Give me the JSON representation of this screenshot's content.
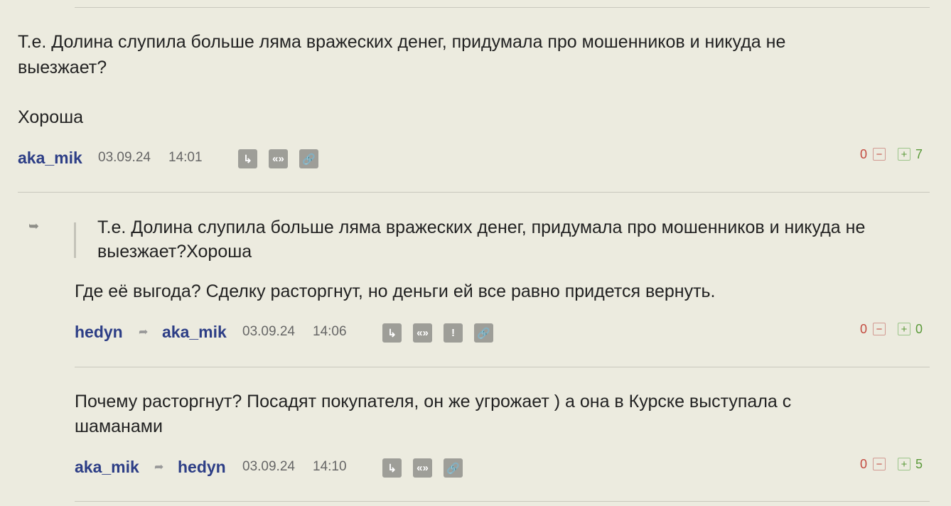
{
  "comments": [
    {
      "text_line1": "Т.е. Долина слупила больше ляма вражеских денег, придумала про мошенников и никуда не",
      "text_line2": "выезжает?",
      "text_line3": "Хороша",
      "author": "aka_mik",
      "date": "03.09.24",
      "time": "14:01",
      "votes": {
        "minus": "0",
        "plus": "7"
      }
    },
    {
      "quote_line1": "Т.е. Долина слупила больше ляма вражеских денег, придумала про мошенников и никуда не",
      "quote_line2": "выезжает?Хороша",
      "text": "Где её выгода? Сделку расторгнут, но деньги ей все равно придется вернуть.",
      "author": "hedyn",
      "reply_to": "aka_mik",
      "date": "03.09.24",
      "time": "14:06",
      "votes": {
        "minus": "0",
        "plus": "0"
      }
    },
    {
      "text_line1": "Почему расторгнут? Посадят покупателя, он же угрожает ) а она в Курске выступала с",
      "text_line2": "шаманами",
      "author": "aka_mik",
      "reply_to": "hedyn",
      "date": "03.09.24",
      "time": "14:10",
      "votes": {
        "minus": "0",
        "plus": "5"
      }
    }
  ],
  "icons": {
    "reply": "reply-arrow-icon",
    "quote": "quote-icon",
    "report": "report-icon",
    "link": "link-icon",
    "thread": "thread-arrow-icon"
  },
  "glyphs": {
    "reply": "↳",
    "quote": "«»",
    "report": "!",
    "link": "🔗",
    "thread": "➥",
    "reply_to": "➦",
    "minus": "−",
    "plus": "+"
  }
}
